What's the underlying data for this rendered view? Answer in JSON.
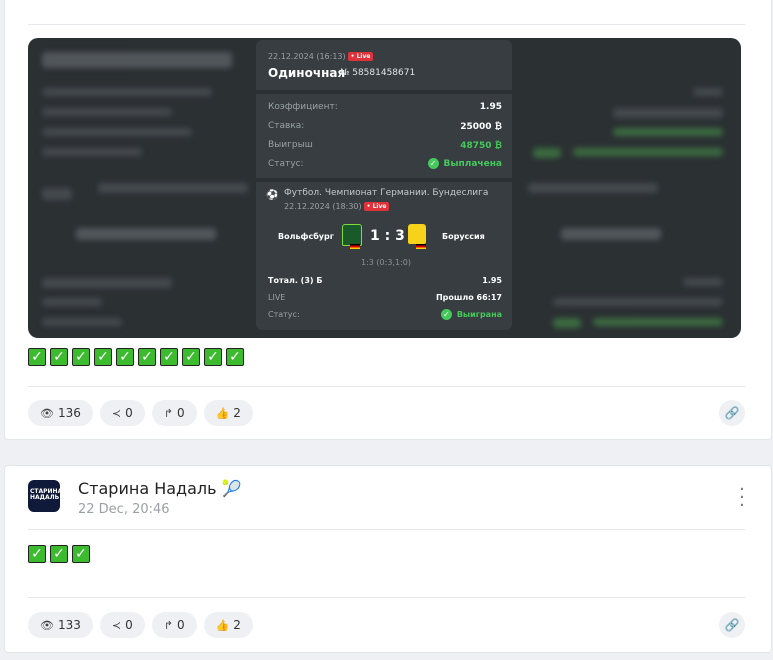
{
  "post1": {
    "ticket": {
      "date": "22.12.2024 (16:13)",
      "live": "• Live",
      "type": "Одиночная",
      "number": "№ 58581458671",
      "coef_label": "Коэффициент:",
      "coef_value": "1.95",
      "stake_label": "Ставка:",
      "stake_value": "25000 ₿",
      "win_label": "Выигрыш",
      "win_value": "48750 ₿",
      "status_label": "Статус:",
      "status_value": "Выплачена",
      "league": "Футбол. Чемпионат Германии. Бундеслига",
      "match_date": "22.12.2024 (18:30)",
      "team1": "Вольфсбург",
      "score": "1 : 3",
      "team2": "Боруссия",
      "halves": "1:3 (0:3,1:0)",
      "market": "Тотал. (3) Б",
      "market_coef": "1.95",
      "live_label": "LIVE",
      "elapsed": "Прошло 66:17",
      "result_label": "Статус:",
      "result_value": "Выиграна"
    },
    "checkmark_count": 10,
    "stats": {
      "views": "136",
      "shares": "0",
      "reposts": "0",
      "likes": "2"
    }
  },
  "post2": {
    "author": "Старина Надаль 🎾",
    "date": "22 Dec, 20:46",
    "avatar_text": "СТАРИНА НАДАЛЬ",
    "checkmark_count": 3,
    "stats": {
      "views": "133",
      "shares": "0",
      "reposts": "0",
      "likes": "2"
    }
  },
  "icons": {
    "views": "eye-icon",
    "shares": "share-icon",
    "reposts": "repost-icon",
    "likes": "thumbs-up-icon",
    "link": "link-icon",
    "menu": "kebab-menu-icon"
  },
  "colors": {
    "accent_green": "#44c95a",
    "live_red": "#e0323a",
    "ticket_bg": "#373d41"
  }
}
